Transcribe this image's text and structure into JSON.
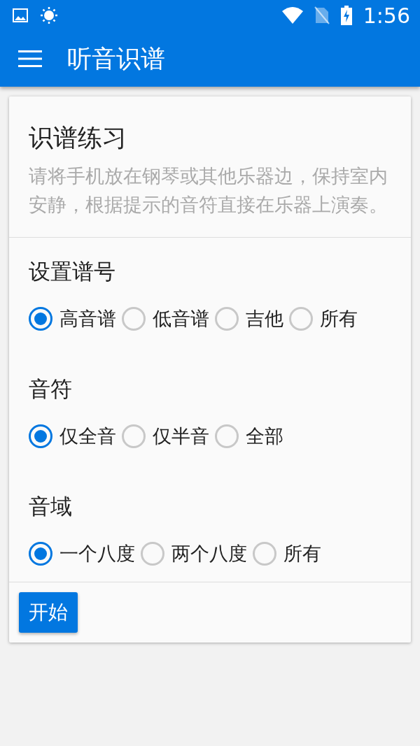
{
  "status_bar": {
    "time": "1:56"
  },
  "app_bar": {
    "title": "听音识谱"
  },
  "card": {
    "title": "识谱练习",
    "description": "请将手机放在钢琴或其他乐器边，保持室内安静，根据提示的音符直接在乐器上演奏。",
    "groups": [
      {
        "label": "设置谱号",
        "options": [
          {
            "label": "高音谱",
            "selected": true
          },
          {
            "label": "低音谱",
            "selected": false
          },
          {
            "label": "吉他",
            "selected": false
          },
          {
            "label": "所有",
            "selected": false
          }
        ]
      },
      {
        "label": "音符",
        "options": [
          {
            "label": "仅全音",
            "selected": true
          },
          {
            "label": "仅半音",
            "selected": false
          },
          {
            "label": "全部",
            "selected": false
          }
        ]
      },
      {
        "label": "音域",
        "options": [
          {
            "label": "一个八度",
            "selected": true
          },
          {
            "label": "两个八度",
            "selected": false
          },
          {
            "label": "所有",
            "selected": false
          }
        ]
      }
    ],
    "button": "开始"
  }
}
